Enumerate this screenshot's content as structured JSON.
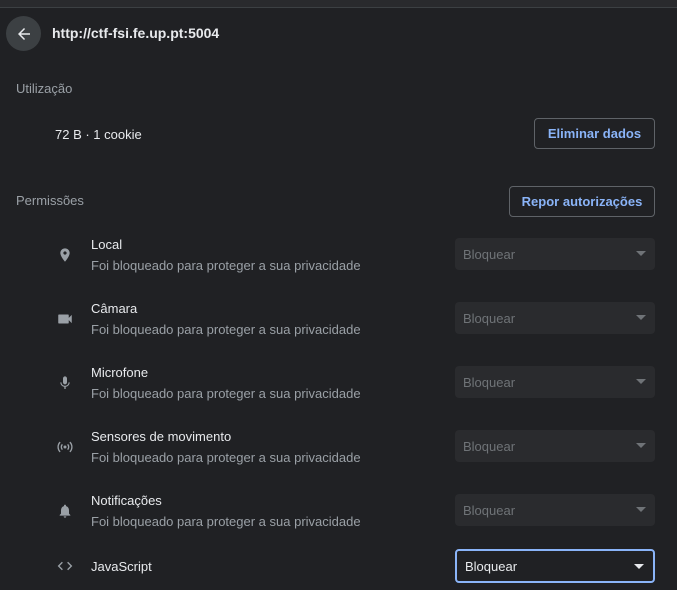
{
  "site": {
    "url": "http://ctf-fsi.fe.up.pt:5004"
  },
  "usage": {
    "title": "Utilização",
    "summary": "72 B · 1 cookie",
    "clear_button": "Eliminar dados"
  },
  "permissions": {
    "title": "Permissões",
    "reset_button": "Repor autorizações",
    "items": [
      {
        "name": "Local",
        "description": "Foi bloqueado para proteger a sua privacidade",
        "value": "Bloquear",
        "icon": "location-pin-icon"
      },
      {
        "name": "Câmara",
        "description": "Foi bloqueado para proteger a sua privacidade",
        "value": "Bloquear",
        "icon": "camera-icon"
      },
      {
        "name": "Microfone",
        "description": "Foi bloqueado para proteger a sua privacidade",
        "value": "Bloquear",
        "icon": "microphone-icon"
      },
      {
        "name": "Sensores de movimento",
        "description": "Foi bloqueado para proteger a sua privacidade",
        "value": "Bloquear",
        "icon": "motion-sensor-icon"
      },
      {
        "name": "Notificações",
        "description": "Foi bloqueado para proteger a sua privacidade",
        "value": "Bloquear",
        "icon": "bell-icon"
      },
      {
        "name": "JavaScript",
        "description": "",
        "value": "Bloquear",
        "icon": "code-icon"
      }
    ]
  },
  "colors": {
    "background": "#202124",
    "accent": "#8ab4f8",
    "text_primary": "#e8eaed",
    "text_secondary": "#9aa0a6"
  }
}
